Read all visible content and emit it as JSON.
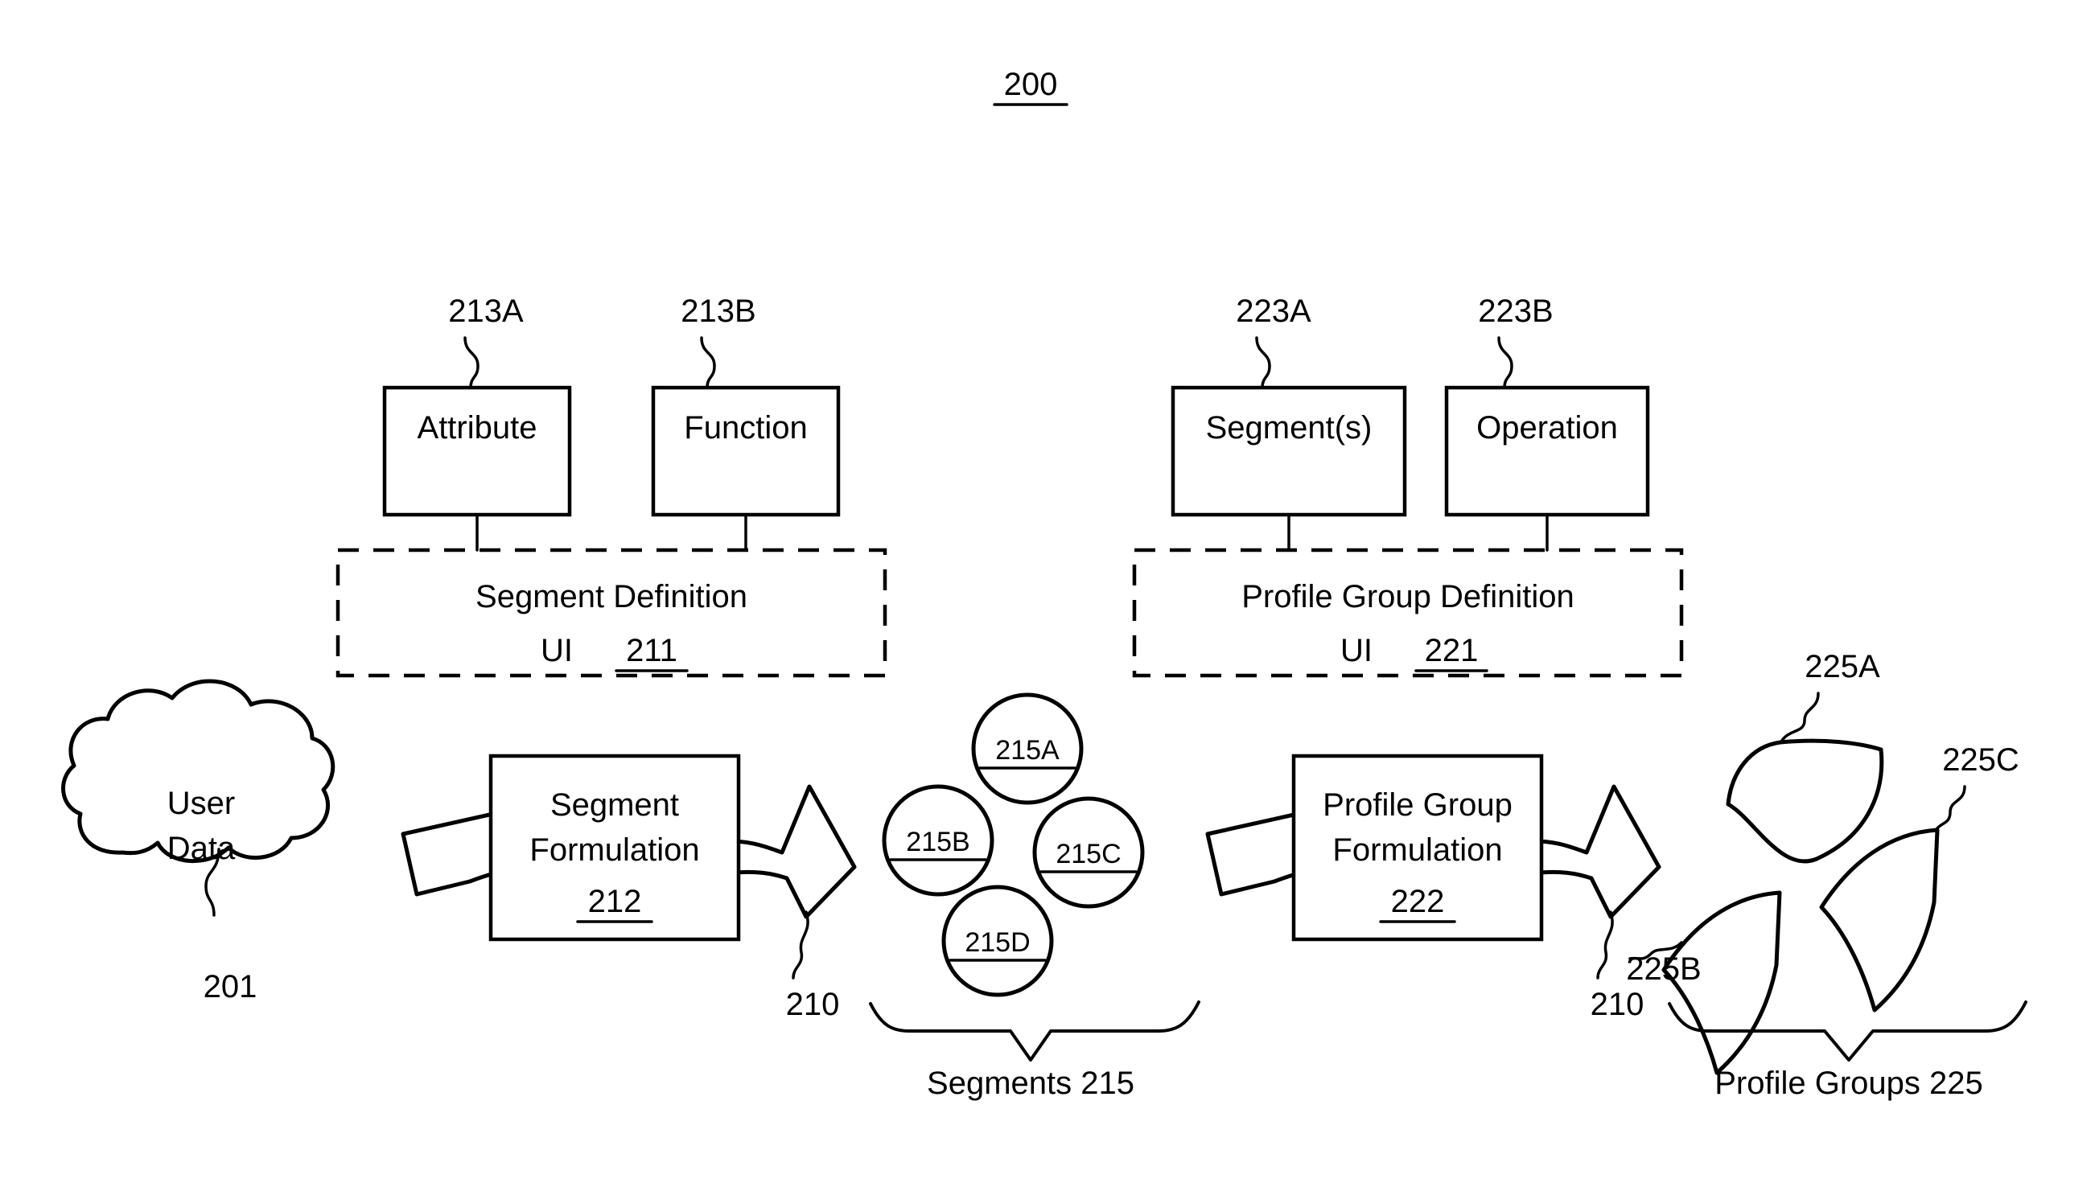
{
  "figure": {
    "number": "200",
    "number_underlined": true
  },
  "source": {
    "cloud_label_line1": "User",
    "cloud_label_line2": "Data",
    "cloud_ref": "201"
  },
  "segment_branch": {
    "input_boxes": [
      {
        "label": "Attribute",
        "ref": "213A"
      },
      {
        "label": "Function",
        "ref": "213B"
      }
    ],
    "definition_ui": {
      "title": "Segment Definition",
      "subtitle": "UI",
      "ref": "211",
      "ref_underlined": true,
      "dashed_border": true
    },
    "process": {
      "line1": "Segment",
      "line2": "Formulation",
      "ref": "212",
      "ref_underlined": true,
      "arrow_ref": "210"
    },
    "outputs": {
      "items": [
        {
          "ref": "215A",
          "shape": "circle"
        },
        {
          "ref": "215B",
          "shape": "circle"
        },
        {
          "ref": "215C",
          "shape": "circle"
        },
        {
          "ref": "215D",
          "shape": "circle"
        }
      ],
      "brace_label": "Segments 215"
    }
  },
  "profile_group_branch": {
    "input_boxes": [
      {
        "label": "Segment(s)",
        "ref": "223A"
      },
      {
        "label": "Operation",
        "ref": "223B"
      }
    ],
    "definition_ui": {
      "title": "Profile Group Definition",
      "subtitle": "UI",
      "ref": "221",
      "ref_underlined": true,
      "dashed_border": true
    },
    "process": {
      "line1": "Profile Group",
      "line2": "Formulation",
      "ref": "222",
      "ref_underlined": true,
      "arrow_ref": "210"
    },
    "outputs": {
      "items": [
        {
          "ref": "225A",
          "shape": "lens"
        },
        {
          "ref": "225B",
          "shape": "sector"
        },
        {
          "ref": "225C",
          "shape": "sector"
        }
      ],
      "brace_label": "Profile Groups 225"
    }
  },
  "colors": {
    "ink": "#000000",
    "paper": "#ffffff"
  }
}
